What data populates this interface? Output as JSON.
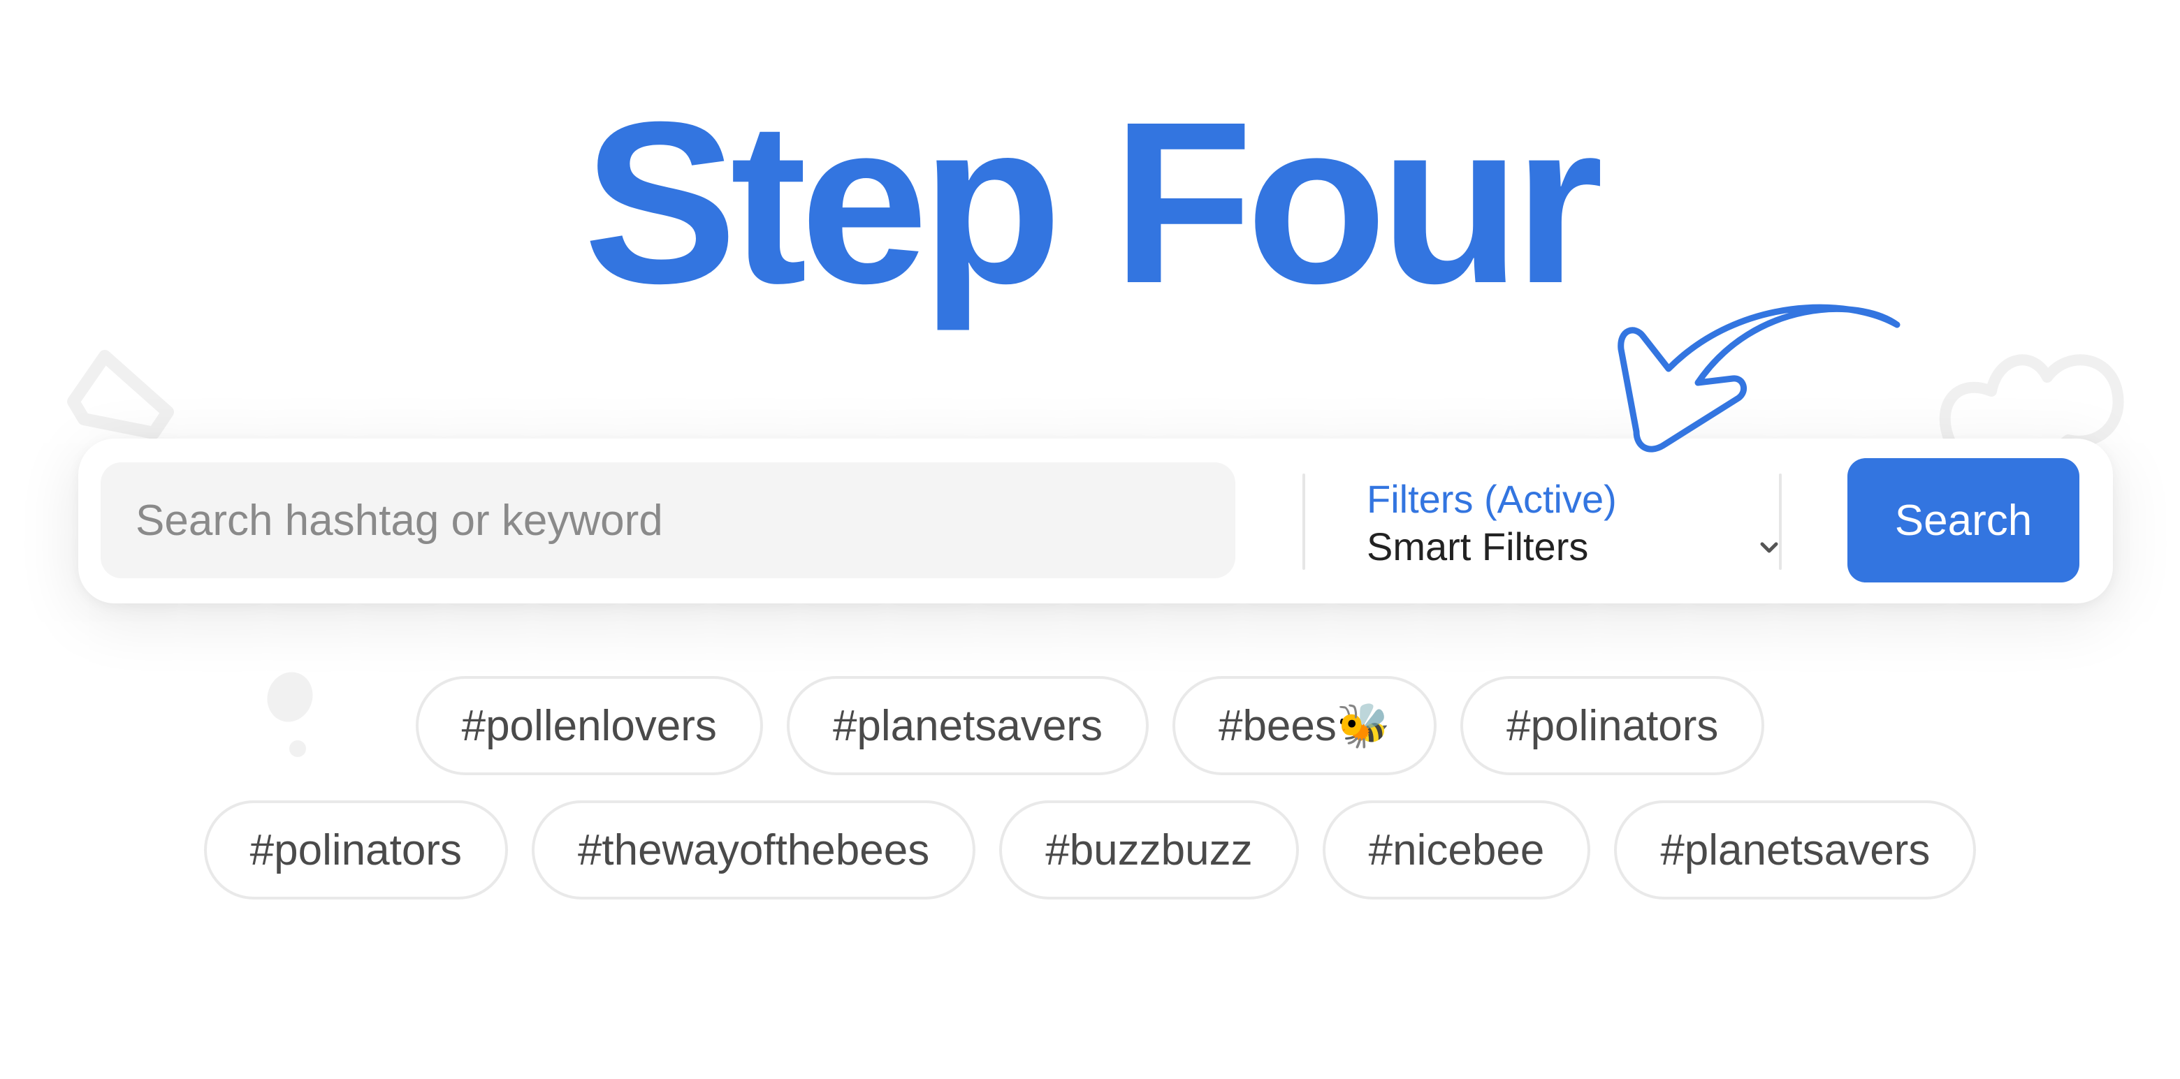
{
  "heading": {
    "title": "Step Four"
  },
  "search": {
    "placeholder": "Search hashtag or keyword",
    "value": ""
  },
  "filters": {
    "status_label": "Filters (Active)",
    "selected": "Smart Filters",
    "icon": "chevron-down-icon"
  },
  "search_button": {
    "label": "Search"
  },
  "hashtags": {
    "row1": [
      "#pollenlovers",
      "#planetsavers",
      "#bees🐝",
      "#polinators"
    ],
    "row2": [
      "#polinators",
      "#thewayofthebees",
      "#buzzbuzz",
      "#nicebee",
      "#planetsavers"
    ]
  },
  "colors": {
    "accent": "#3375e0",
    "tag_border": "#e9e9e9",
    "input_bg": "#f4f4f4"
  },
  "annotation": {
    "icon": "curved-arrow-icon"
  }
}
